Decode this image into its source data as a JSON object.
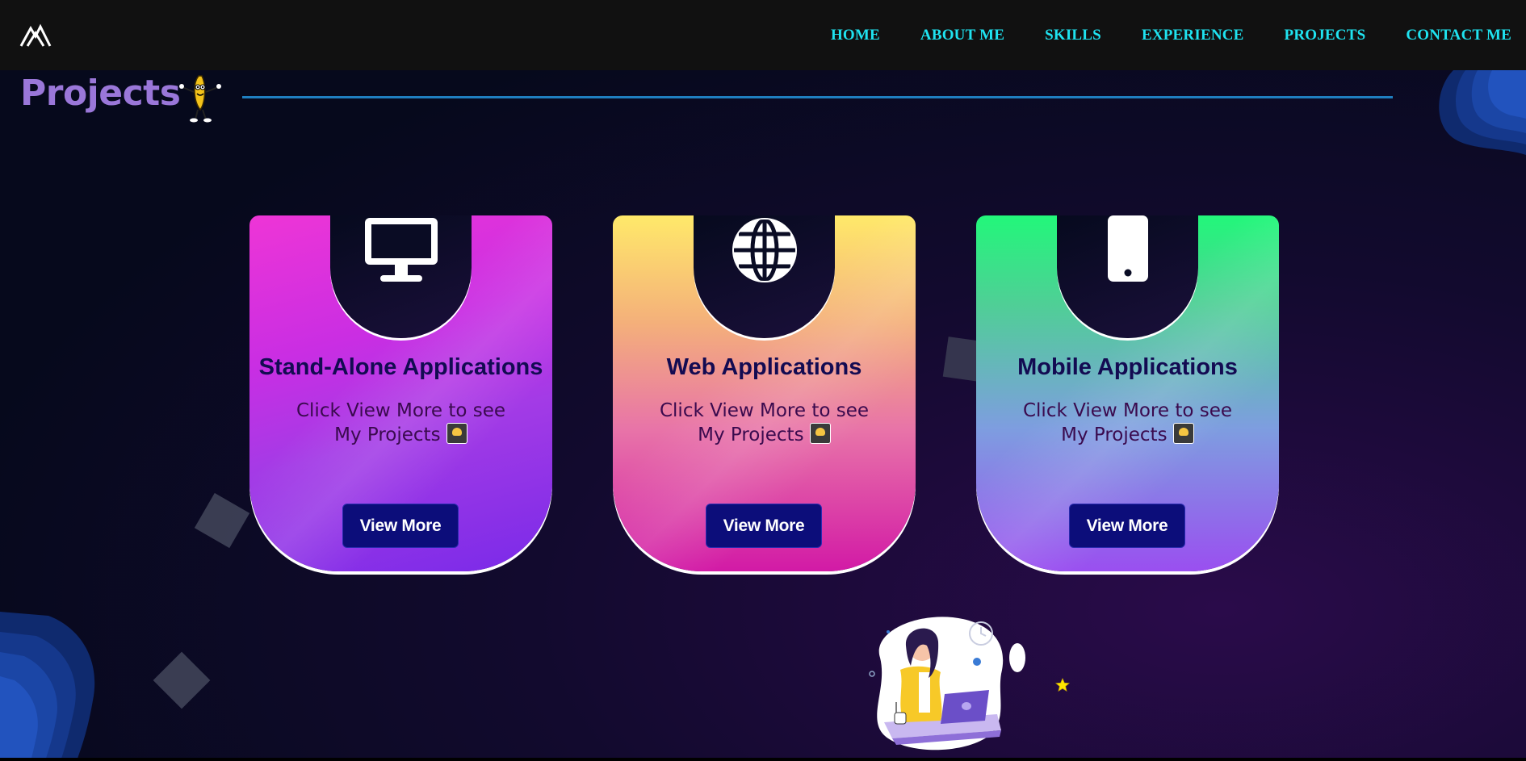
{
  "nav": {
    "items": [
      "HOME",
      "ABOUT ME",
      "SKILLS",
      "EXPERIENCE",
      "PROJECTS",
      "CONTACT ME"
    ]
  },
  "section": {
    "title": "Projects"
  },
  "cards": [
    {
      "icon": "monitor-icon",
      "title": "Stand-Alone Applications",
      "description": "Click View More to see My Projects",
      "button": "View More"
    },
    {
      "icon": "globe-icon",
      "title": "Web Applications",
      "description": "Click View More to see My Projects",
      "button": "View More"
    },
    {
      "icon": "smartphone-icon",
      "title": "Mobile Applications",
      "description": "Click View More to see My Projects",
      "button": "View More"
    }
  ],
  "colors": {
    "nav_link": "#1fe3f0",
    "title": "#9a77d9",
    "button_bg": "#0c0d7a",
    "card1_top": "#ee35d6",
    "card2_top": "#ffe96a",
    "card3_top": "#22f77a"
  }
}
